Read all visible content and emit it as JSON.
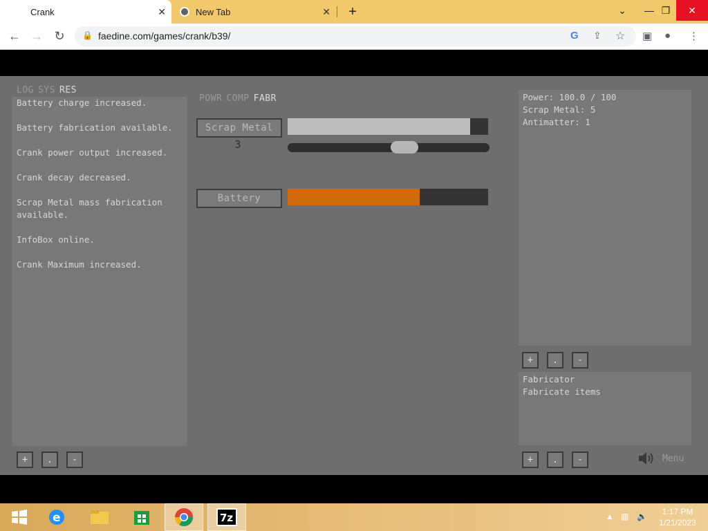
{
  "browser": {
    "tabs": [
      {
        "title": "Crank",
        "active": true
      },
      {
        "title": "New Tab",
        "active": false
      }
    ],
    "url": "faedine.com/games/crank/b39/"
  },
  "game": {
    "left_tabs": [
      "LOG",
      "SYS",
      "RES"
    ],
    "left_active": "RES",
    "log_lines": [
      "Battery charge increased.",
      "Battery fabrication available.",
      "Crank power output increased.",
      "Crank decay decreased.",
      "Scrap Metal mass fabrication available.",
      "InfoBox online.",
      "Crank Maximum increased."
    ],
    "center_tabs": [
      "POWR",
      "COMP",
      "FABR"
    ],
    "center_active": "FABR",
    "fabricate": [
      {
        "label": "Scrap Metal",
        "count": "3",
        "progress": 0.91,
        "fill_color": "#bdbdbd"
      },
      {
        "label": "Battery",
        "progress": 0.66,
        "fill_color": "#d26a0a"
      }
    ],
    "slider_value": 0.59,
    "stats": [
      "Power: 100.0 / 100",
      "Scrap Metal: 5",
      "Antimatter: 1"
    ],
    "info": [
      "Fabricator",
      "Fabricate items"
    ],
    "zoom_buttons": [
      "+",
      ".",
      "-"
    ],
    "menu_label": "Menu"
  },
  "taskbar": {
    "time": "1:17 PM",
    "date": "1/21/2023"
  }
}
